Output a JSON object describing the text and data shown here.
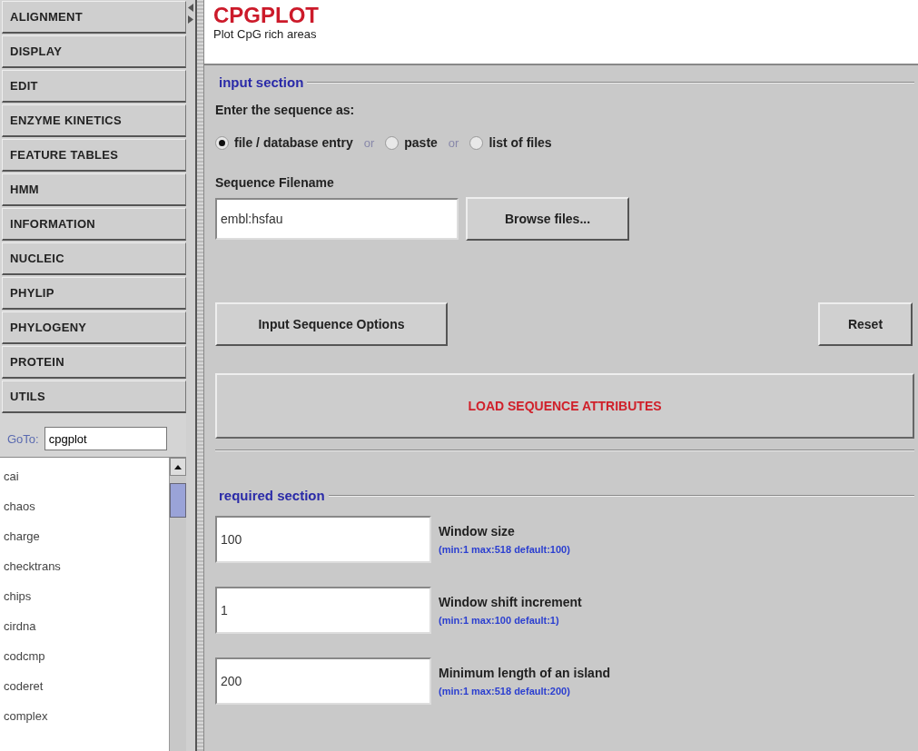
{
  "sidebar": {
    "groups": [
      {
        "label": "ALIGNMENT"
      },
      {
        "label": "DISPLAY"
      },
      {
        "label": "EDIT"
      },
      {
        "label": "ENZYME KINETICS"
      },
      {
        "label": "FEATURE TABLES"
      },
      {
        "label": "HMM"
      },
      {
        "label": "INFORMATION"
      },
      {
        "label": "NUCLEIC"
      },
      {
        "label": "PHYLIP"
      },
      {
        "label": "PHYLOGENY"
      },
      {
        "label": "PROTEIN"
      },
      {
        "label": "UTILS"
      }
    ],
    "goto": {
      "label": "GoTo:",
      "value": "cpgplot"
    },
    "programs": [
      "cai",
      "chaos",
      "charge",
      "checktrans",
      "chips",
      "cirdna",
      "codcmp",
      "coderet",
      "complex"
    ]
  },
  "header": {
    "title": "CPGPLOT",
    "subtitle": "Plot CpG rich areas"
  },
  "input_section": {
    "title": "input section",
    "prompt": "Enter the sequence as:",
    "options": [
      {
        "label": "file / database entry",
        "selected": true
      },
      {
        "label": "paste",
        "selected": false
      },
      {
        "label": "list of files",
        "selected": false
      }
    ],
    "separators": [
      "or",
      "or"
    ],
    "filename_label": "Sequence Filename",
    "filename_value": "embl:hsfau",
    "browse_button": "Browse files...",
    "options_button": "Input Sequence Options",
    "reset_button": "Reset",
    "load_button": "LOAD SEQUENCE ATTRIBUTES"
  },
  "required_section": {
    "title": "required section",
    "fields": [
      {
        "value": "100",
        "label": "Window size",
        "hint": "(min:1 max:518 default:100)"
      },
      {
        "value": "1",
        "label": "Window shift increment",
        "hint": "(min:1 max:100 default:1)"
      },
      {
        "value": "200",
        "label": "Minimum length of an island",
        "hint": "(min:1 max:518 default:200)"
      }
    ]
  }
}
